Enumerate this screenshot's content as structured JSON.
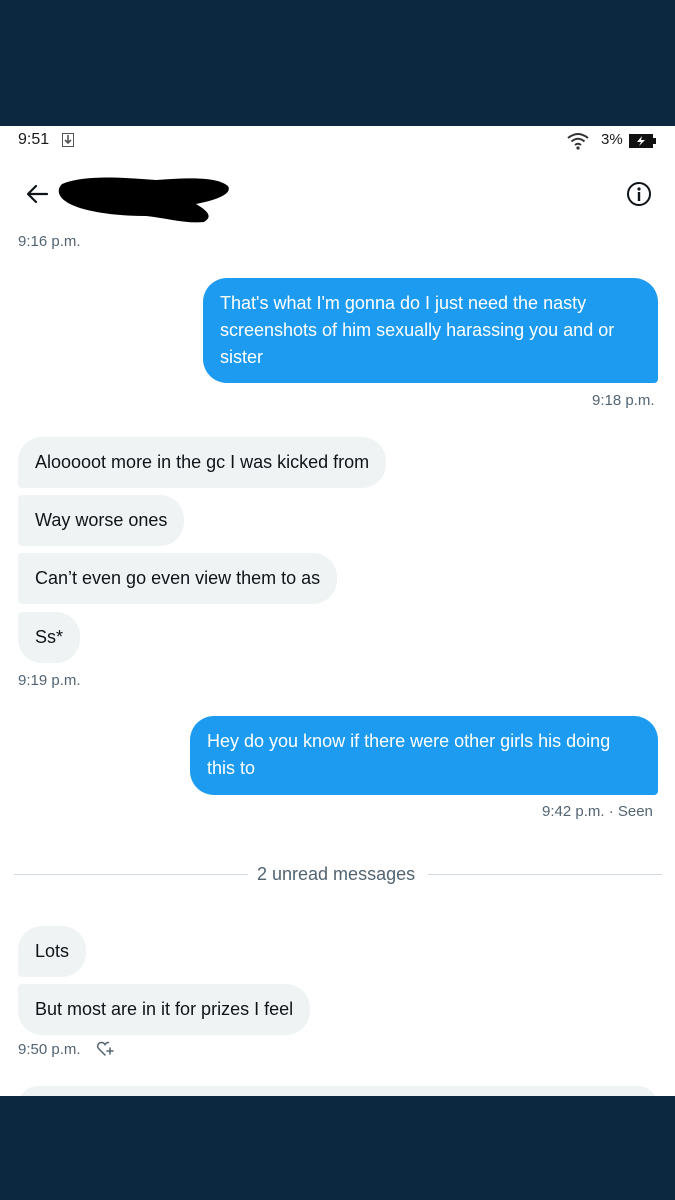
{
  "status_bar": {
    "time": "9:51",
    "battery": "3%",
    "icons": [
      "download-icon",
      "wifi-icon",
      "battery-charging-icon"
    ]
  },
  "header": {
    "back_icon": "back-arrow-icon",
    "info_icon": "info-icon"
  },
  "conversation": {
    "timestamp_1": "9:16 p.m.",
    "out_1": "That's what I'm gonna do I just need the nasty screenshots of him sexually harassing you and or sister",
    "timestamp_2": "9:18 p.m.",
    "in_1": "Alooooot more in the gc I was kicked from",
    "in_2": "Way worse ones",
    "in_3": "Can’t even go even view them to as",
    "in_4": "Ss*",
    "timestamp_3": "9:19 p.m.",
    "out_2": "Hey do you know if there were other girls his doing this to",
    "timestamp_4": "9:42 p.m. · Seen",
    "unread_divider": "2 unread messages",
    "in_5": "Lots",
    "in_6": "But most are in it for prizes I feel",
    "timestamp_5": "9:50 p.m."
  },
  "colors": {
    "outgoing_bubble": "#1d9bf0",
    "incoming_bubble": "#eff3f4",
    "frame": "#0c2840",
    "meta_text": "#536471"
  }
}
